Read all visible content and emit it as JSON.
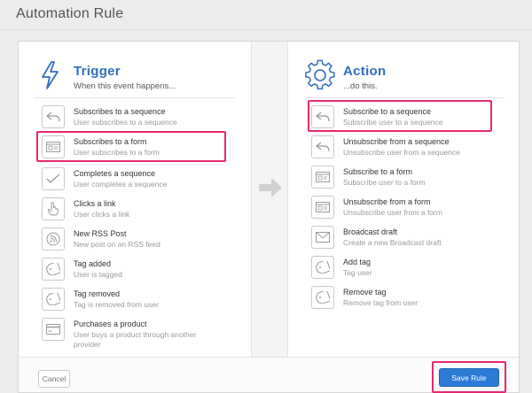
{
  "page_title": "Automation Rule",
  "trigger": {
    "title": "Trigger",
    "subtitle": "When this event happens...",
    "items": [
      {
        "title": "Subscribes to a sequence",
        "desc": "User subscribes to a sequence",
        "icon": "reply-arrow-icon",
        "selected": false
      },
      {
        "title": "Subscribes to a form",
        "desc": "User subscribes to a form",
        "icon": "form-icon",
        "selected": true
      },
      {
        "title": "Completes a sequence",
        "desc": "User completes a sequence",
        "icon": "checkmark-icon",
        "selected": false
      },
      {
        "title": "Clicks a link",
        "desc": "User clicks a link",
        "icon": "pointer-hand-icon",
        "selected": false
      },
      {
        "title": "New RSS Post",
        "desc": "New post on an RSS feed",
        "icon": "rss-icon",
        "selected": false
      },
      {
        "title": "Tag added",
        "desc": "User is tagged",
        "icon": "tag-icon",
        "selected": false
      },
      {
        "title": "Tag removed",
        "desc": "Tag is removed from user",
        "icon": "tag-icon",
        "selected": false
      },
      {
        "title": "Purchases a product",
        "desc": "User buys a product through another provider",
        "icon": "credit-card-icon",
        "selected": false
      }
    ]
  },
  "action": {
    "title": "Action",
    "subtitle": "...do this.",
    "items": [
      {
        "title": "Subscribe to a sequence",
        "desc": "Subscribe user to a sequence",
        "icon": "reply-arrow-icon",
        "selected": true
      },
      {
        "title": "Unsubscribe from a sequence",
        "desc": "Unsubscribe user from a sequence",
        "icon": "reply-arrow-icon",
        "selected": false
      },
      {
        "title": "Subscribe to a form",
        "desc": "Subscribe user to a form",
        "icon": "form-icon",
        "selected": false
      },
      {
        "title": "Unsubscribe from a form",
        "desc": "Unsubscribe user from a form",
        "icon": "form-icon",
        "selected": false
      },
      {
        "title": "Broadcast draft",
        "desc": "Create a new Broadcast draft",
        "icon": "envelope-icon",
        "selected": false
      },
      {
        "title": "Add tag",
        "desc": "Tag user",
        "icon": "tag-icon",
        "selected": false
      },
      {
        "title": "Remove tag",
        "desc": "Remove tag from user",
        "icon": "tag-icon",
        "selected": false
      }
    ]
  },
  "footer": {
    "cancel_label": "Cancel",
    "save_label": "Save Rule"
  },
  "colors": {
    "accent": "#2e6fbf",
    "button_primary": "#2c7ad6",
    "highlight": "#e6296d"
  }
}
